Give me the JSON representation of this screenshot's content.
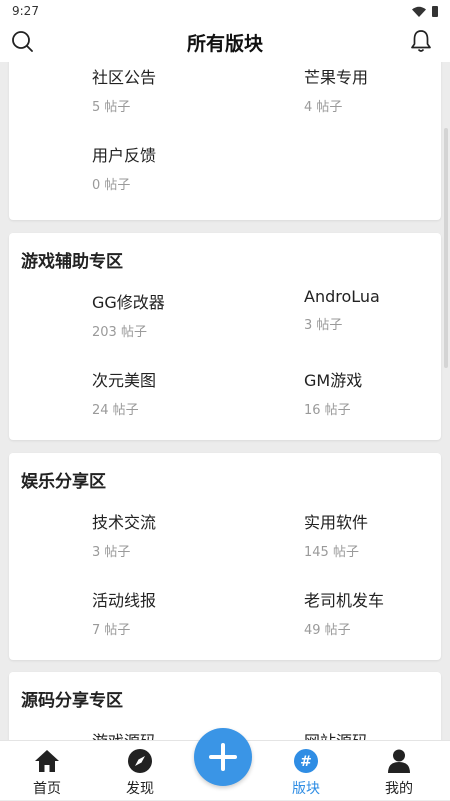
{
  "status_bar": {
    "time": "9:27"
  },
  "app_bar": {
    "title": "所有版块"
  },
  "sections": [
    {
      "title": "",
      "forums": [
        {
          "name": "社区公告",
          "count": "5 帖子"
        },
        {
          "name": "芒果专用",
          "count": "4 帖子"
        },
        {
          "name": "用户反馈",
          "count": "0 帖子"
        }
      ]
    },
    {
      "title": "游戏辅助专区",
      "forums": [
        {
          "name": "GG修改器",
          "count": "203 帖子"
        },
        {
          "name": "AndroLua",
          "count": "3 帖子"
        },
        {
          "name": "次元美图",
          "count": "24 帖子"
        },
        {
          "name": "GM游戏",
          "count": "16 帖子"
        }
      ]
    },
    {
      "title": "娱乐分享区",
      "forums": [
        {
          "name": "技术交流",
          "count": "3 帖子"
        },
        {
          "name": "实用软件",
          "count": "145 帖子"
        },
        {
          "name": "活动线报",
          "count": "7 帖子"
        },
        {
          "name": "老司机发车",
          "count": "49 帖子"
        }
      ]
    },
    {
      "title": "源码分享专区",
      "forums": [
        {
          "name": "游戏源码",
          "count": ""
        },
        {
          "name": "网站源码",
          "count": ""
        }
      ]
    }
  ],
  "bottom_nav": {
    "items": [
      {
        "label": "首页",
        "icon": "home-icon"
      },
      {
        "label": "发现",
        "icon": "compass-icon"
      },
      {
        "label": "版块",
        "icon": "hashtag-icon"
      },
      {
        "label": "我的",
        "icon": "person-icon"
      }
    ],
    "active_index": 2,
    "fab_icon": "plus-icon"
  },
  "colors": {
    "accent": "#3a95e6",
    "active_label": "#2f8de4",
    "background": "#ececec"
  }
}
